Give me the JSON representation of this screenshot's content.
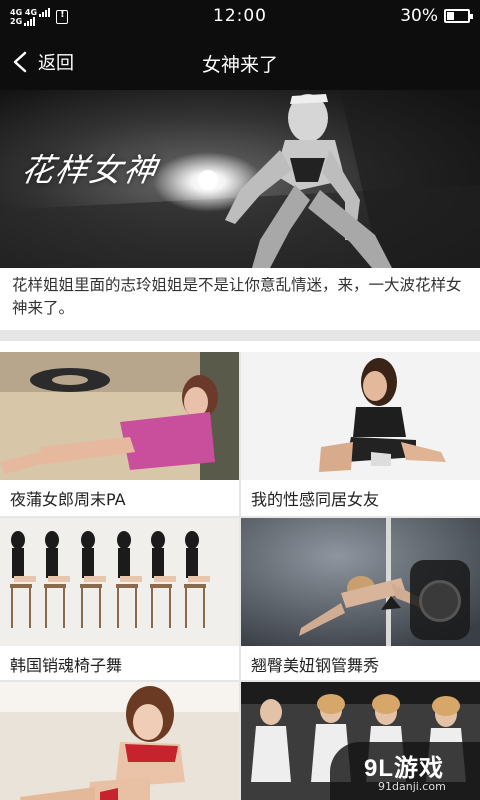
{
  "status_bar": {
    "network_top": "4G 4G",
    "network_bottom": "2G",
    "time": "12:00",
    "battery": "30%",
    "battery_level": 0.3
  },
  "nav": {
    "back_label": "返回",
    "title": "女神来了"
  },
  "hero": {
    "overlay_text": "花样女神",
    "caption": "花样姐姐里面的志玲姐姐是不是让你意乱情迷，来，一大波花样女神来了。"
  },
  "grid": {
    "items": [
      {
        "label": "夜蒲女郎周末PA"
      },
      {
        "label": "我的性感同居女友"
      },
      {
        "label": "韩国销魂椅子舞"
      },
      {
        "label": "翘臀美妞钢管舞秀"
      },
      {
        "label": ""
      },
      {
        "label": ""
      }
    ]
  },
  "watermark": {
    "main": "9L游戏",
    "sub": "91danji.com"
  }
}
